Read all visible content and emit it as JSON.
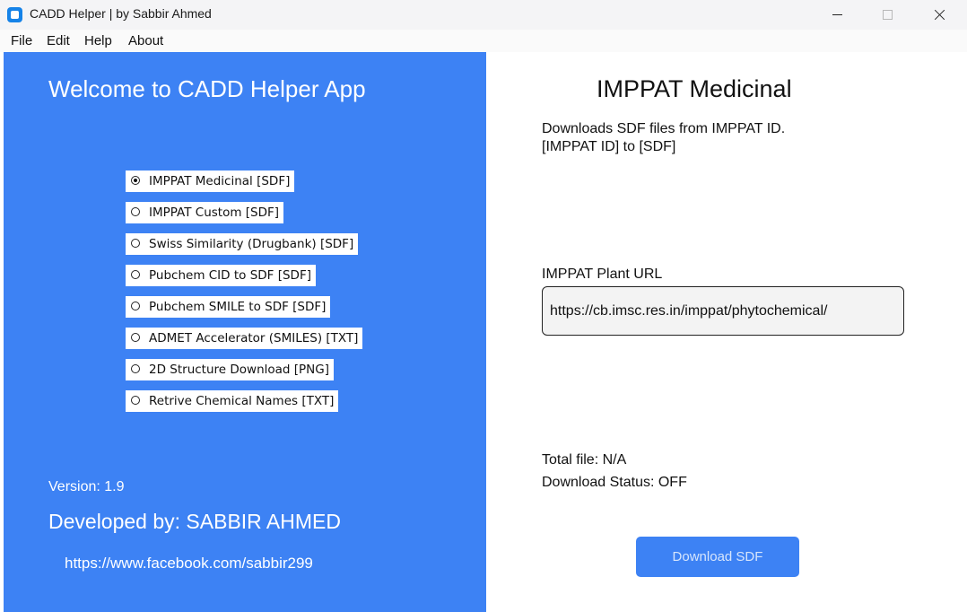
{
  "window": {
    "title": "CADD Helper | by Sabbir Ahmed",
    "icon": "app-icon"
  },
  "menu": [
    "File",
    "Edit",
    "Help",
    "About"
  ],
  "left": {
    "welcome": "Welcome to CADD Helper App",
    "options": [
      {
        "label": "IMPPAT Medicinal [SDF]",
        "selected": true
      },
      {
        "label": "IMPPAT Custom [SDF]",
        "selected": false
      },
      {
        "label": "Swiss Similarity (Drugbank) [SDF]",
        "selected": false
      },
      {
        "label": "Pubchem CID to SDF [SDF]",
        "selected": false
      },
      {
        "label": "Pubchem SMILE to SDF [SDF]",
        "selected": false
      },
      {
        "label": "ADMET Accelerator (SMILES) [TXT]",
        "selected": false
      },
      {
        "label": "2D Structure Download [PNG]",
        "selected": false
      },
      {
        "label": "Retrive Chemical Names [TXT]",
        "selected": false
      }
    ],
    "version": "Version: 1.9",
    "developed_by": "Developed by: SABBIR AHMED",
    "link": "https://www.facebook.com/sabbir299"
  },
  "right": {
    "title": "IMPPAT Medicinal",
    "description_line1": "Downloads SDF files from IMPPAT ID.",
    "description_line2": "[IMPPAT ID] to [SDF]",
    "url_label": "IMPPAT Plant URL",
    "url_value": "https://cb.imsc.res.in/imppat/phytochemical/",
    "total_file": "Total file: N/A",
    "download_status": "Download Status: OFF",
    "download_button": "Download SDF"
  },
  "colors": {
    "accent": "#3d82f4",
    "app_icon": "#1582e8"
  }
}
